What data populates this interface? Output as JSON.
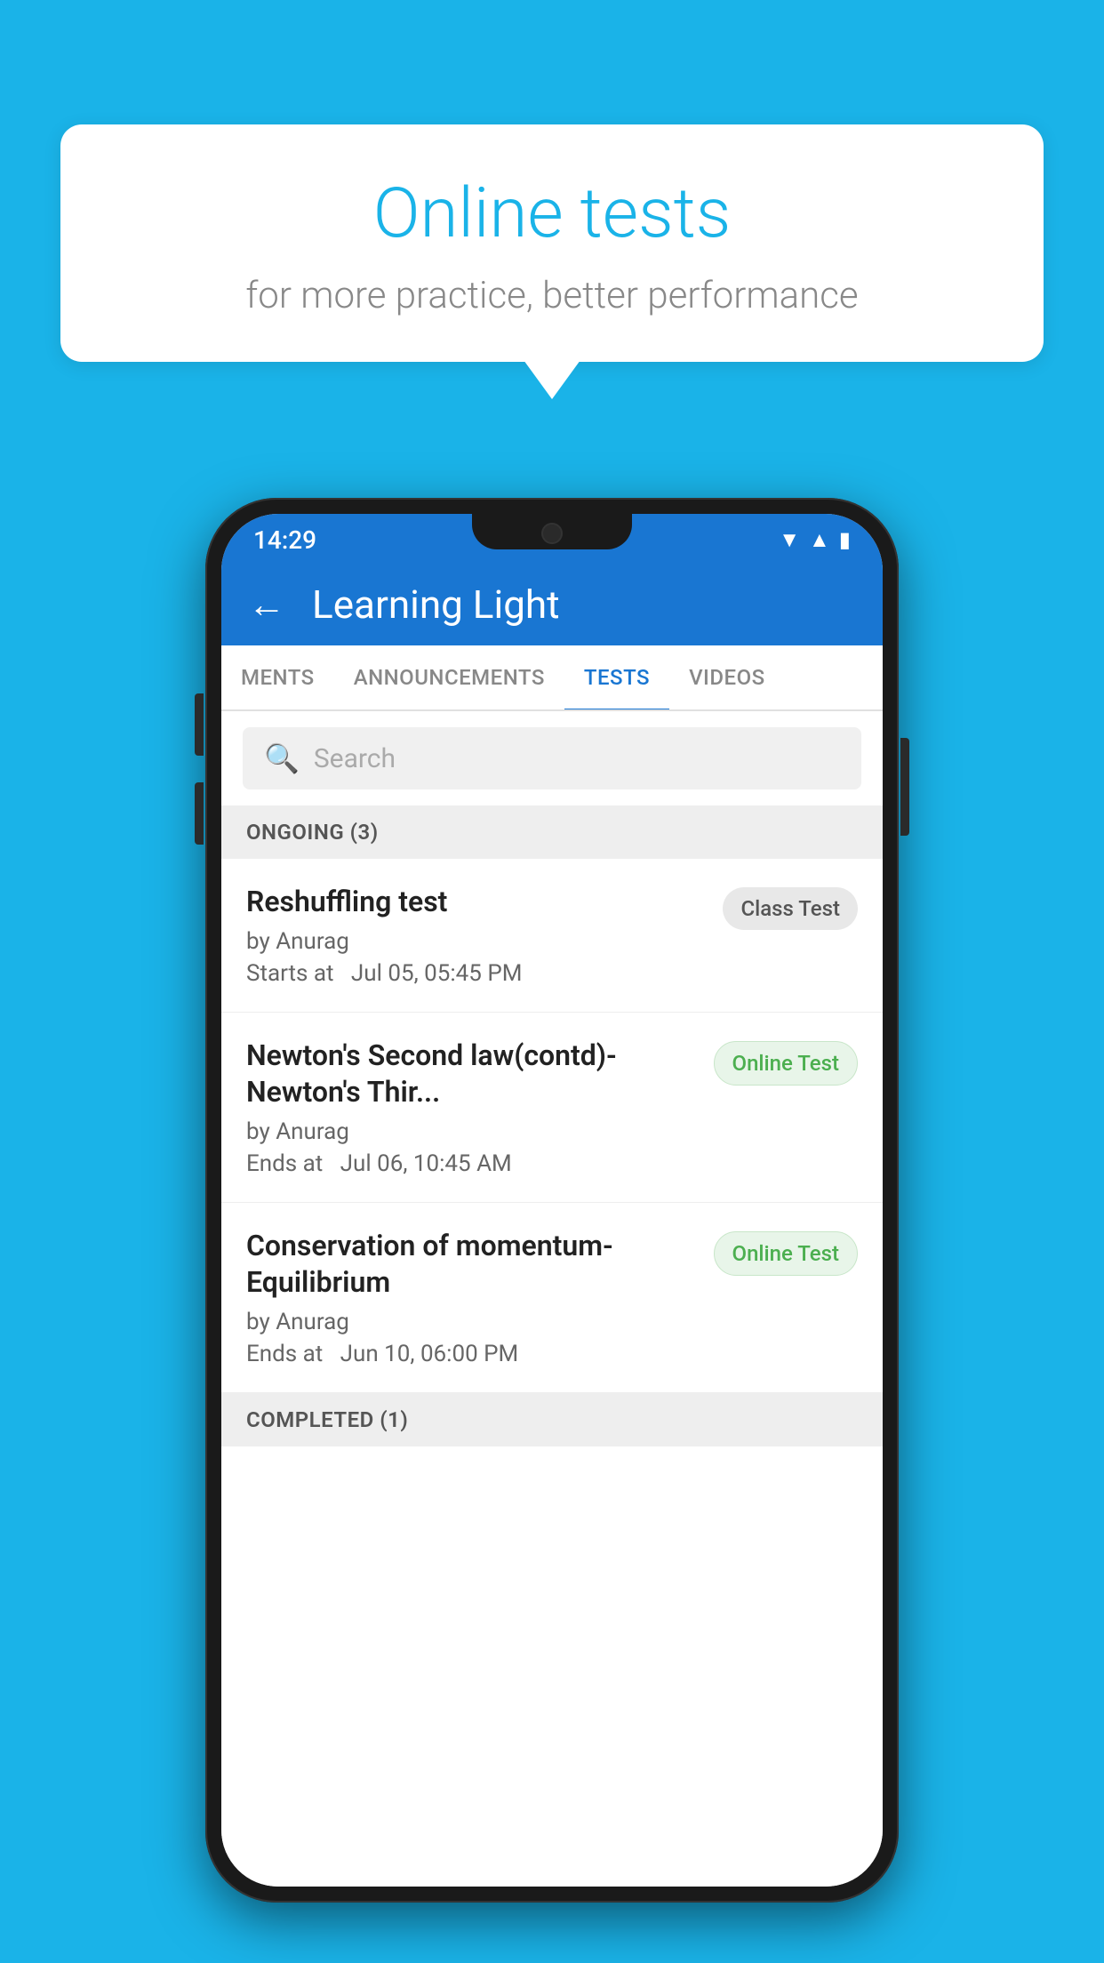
{
  "background_color": "#1ab3e8",
  "speech_bubble": {
    "title": "Online tests",
    "subtitle": "for more practice, better performance"
  },
  "phone": {
    "status_bar": {
      "time": "14:29",
      "icons": [
        "wifi",
        "signal",
        "battery"
      ]
    },
    "app_bar": {
      "back_label": "←",
      "title": "Learning Light"
    },
    "tabs": [
      {
        "label": "MENTS",
        "active": false
      },
      {
        "label": "ANNOUNCEMENTS",
        "active": false
      },
      {
        "label": "TESTS",
        "active": true
      },
      {
        "label": "VIDEOS",
        "active": false
      }
    ],
    "search": {
      "placeholder": "Search"
    },
    "ongoing_section": {
      "header": "ONGOING (3)",
      "tests": [
        {
          "name": "Reshuffling test",
          "author": "by Anurag",
          "date": "Starts at  Jul 05, 05:45 PM",
          "badge": "Class Test",
          "badge_type": "class"
        },
        {
          "name": "Newton's Second law(contd)-Newton's Thir...",
          "author": "by Anurag",
          "date": "Ends at  Jul 06, 10:45 AM",
          "badge": "Online Test",
          "badge_type": "online"
        },
        {
          "name": "Conservation of momentum-Equilibrium",
          "author": "by Anurag",
          "date": "Ends at  Jun 10, 06:00 PM",
          "badge": "Online Test",
          "badge_type": "online"
        }
      ]
    },
    "completed_section": {
      "header": "COMPLETED (1)"
    }
  }
}
